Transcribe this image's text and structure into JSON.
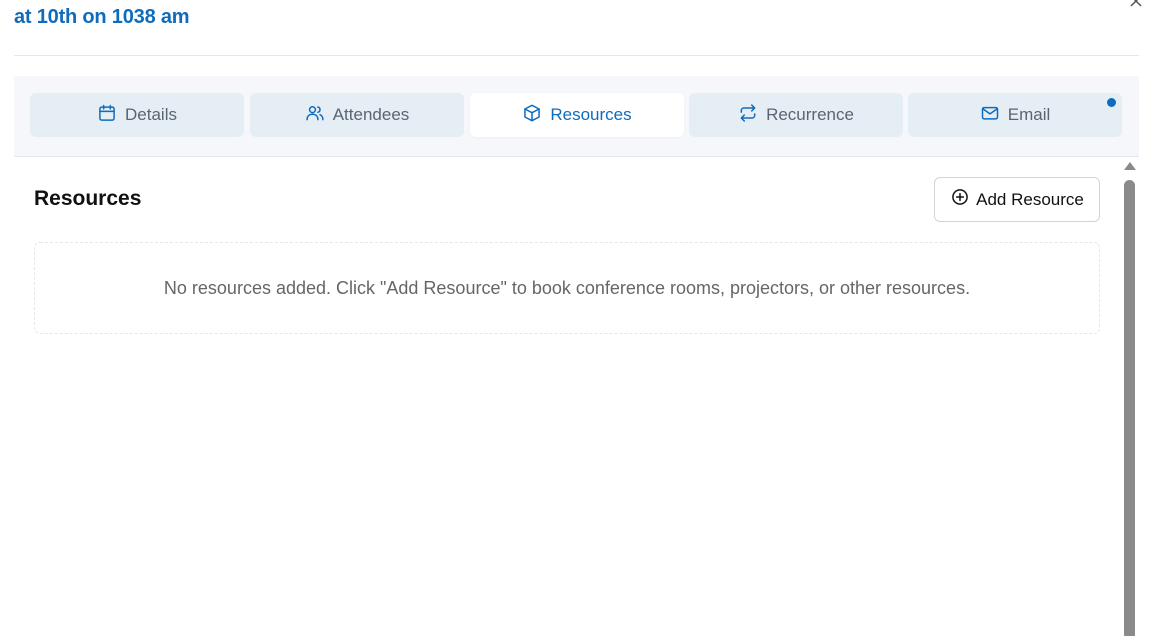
{
  "dialog": {
    "title": "at 10th on 1038 am"
  },
  "tabs": [
    {
      "label": "Details",
      "icon": "calendar-icon",
      "active": false
    },
    {
      "label": "Attendees",
      "icon": "users-icon",
      "active": false
    },
    {
      "label": "Resources",
      "icon": "box-icon",
      "active": true
    },
    {
      "label": "Recurrence",
      "icon": "repeat-icon",
      "active": false
    },
    {
      "label": "Email",
      "icon": "mail-icon",
      "active": false,
      "notification_dot": true
    }
  ],
  "resources": {
    "title": "Resources",
    "add_label": "Add Resource",
    "empty_message": "No resources added. Click \"Add Resource\" to book conference rooms, projectors, or other resources."
  },
  "colors": {
    "accent": "#0f6cbd",
    "tab_inactive_bg": "#e6eef5",
    "tab_strip_bg": "#f5f7fa"
  }
}
